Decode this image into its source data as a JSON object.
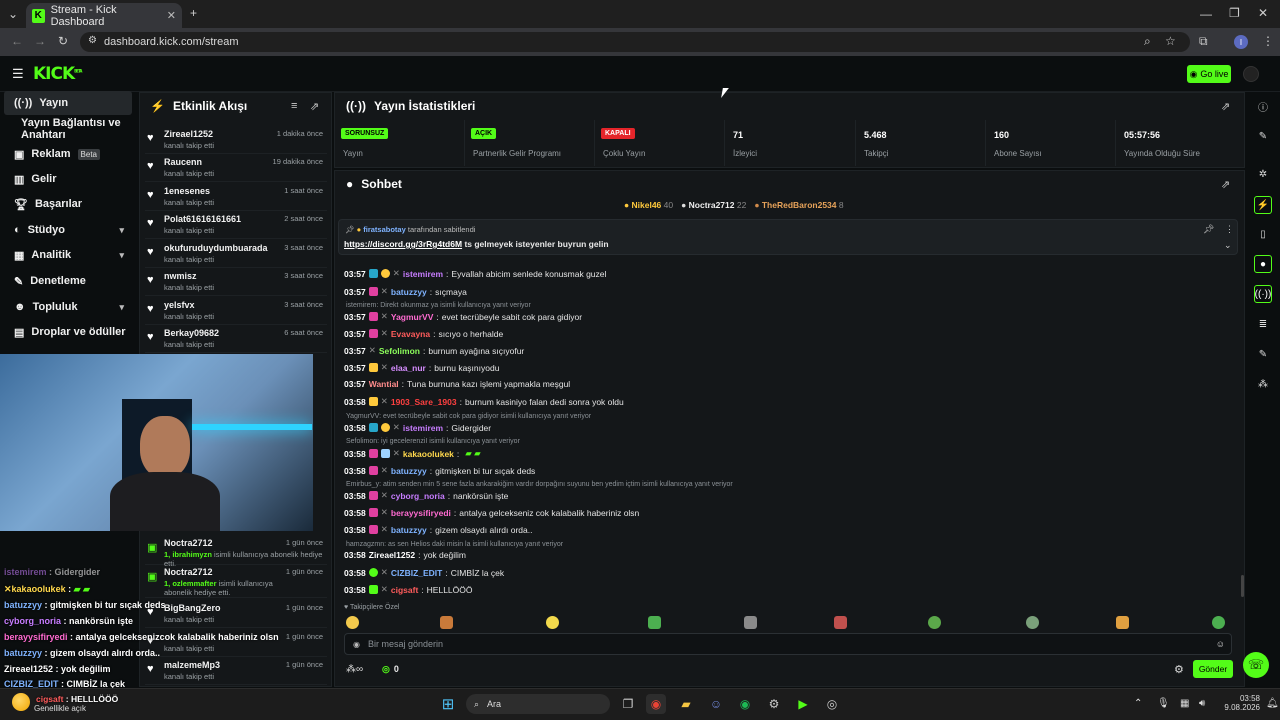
{
  "browser": {
    "tab_title": "Stream - Kick Dashboard",
    "url": "dashboard.kick.com/stream",
    "profile_initial": "I"
  },
  "header": {
    "logo": "KICK",
    "logo_sup": "BETA",
    "go_live": "Go live"
  },
  "sidebar": {
    "items": [
      {
        "label": "Yayın"
      },
      {
        "label": "Yayın Bağlantısı ve Anahtarı"
      },
      {
        "label": "Reklam",
        "badge": "Beta"
      },
      {
        "label": "Gelir"
      },
      {
        "label": "Başarılar"
      },
      {
        "label": "Stüdyo"
      },
      {
        "label": "Analitik"
      },
      {
        "label": "Denetleme"
      },
      {
        "label": "Topluluk"
      },
      {
        "label": "Droplar ve ödüller"
      }
    ]
  },
  "activity": {
    "title": "Etkinlik Akışı",
    "events": [
      {
        "name": "Zireael1252",
        "sub": "kanalı takip etti",
        "time": "1 dakika önce"
      },
      {
        "name": "Raucenn",
        "sub": "kanalı takip etti",
        "time": "19 dakika önce"
      },
      {
        "name": "1enesenes",
        "sub": "kanalı takip etti",
        "time": "1 saat önce"
      },
      {
        "name": "Polat61616161661",
        "sub": "kanalı takip etti",
        "time": "2 saat önce"
      },
      {
        "name": "okufuruduydumbuarada",
        "sub": "kanalı takip etti",
        "time": "3 saat önce"
      },
      {
        "name": "nwmisz",
        "sub": "kanalı takip etti",
        "time": "3 saat önce"
      },
      {
        "name": "yelsfvx",
        "sub": "kanalı takip etti",
        "time": "3 saat önce"
      },
      {
        "name": "Berkay09682",
        "sub": "kanalı takip etti",
        "time": "6 saat önce"
      }
    ],
    "gift_events": [
      {
        "name": "Noctra2712",
        "sub_user": "1, ibrahimyzn",
        "sub": "isimli kullanıcıya abonelik hediye etti.",
        "time": "1 gün önce"
      },
      {
        "name": "Noctra2712",
        "sub_user": "1, ozlemmafter",
        "sub": "isimli kullanıcıya abonelik hediye etti.",
        "time": "1 gün önce"
      },
      {
        "name": "BigBangZero",
        "sub": "kanalı takip etti",
        "time": "1 gün önce"
      },
      {
        "name": "",
        "sub": "kanalı takip etti",
        "time": "1 gün önce"
      },
      {
        "name": "malzemeMp3",
        "sub": "kanalı takip etti",
        "time": "1 gün önce"
      }
    ]
  },
  "stats": {
    "title": "Yayın İstatistikleri",
    "items": [
      {
        "pill": "SORUNSUZ",
        "label": "Yayın"
      },
      {
        "pill": "AÇIK",
        "label": "Partnerlik Gelir Programı"
      },
      {
        "pill": "KAPALI",
        "label": "Çoklu Yayın"
      },
      {
        "value": "71",
        "label": "İzleyici"
      },
      {
        "value": "5.468",
        "label": "Takipçi"
      },
      {
        "value": "160",
        "label": "Abone Sayısı"
      },
      {
        "value": "05:57:56",
        "label": "Yayında Olduğu Süre"
      }
    ]
  },
  "chat": {
    "title": "Sohbet",
    "top": [
      {
        "name": "Nikel46",
        "count": "40"
      },
      {
        "name": "Noctra2712",
        "count": "22"
      },
      {
        "name": "TheRedBaron2534",
        "count": "8"
      }
    ],
    "pinned_by": "firatsabotay",
    "pinned_suffix": "tarafından sabitlendi",
    "pinned_link": "https://discord.gg/3rRg4td6M",
    "pinned_text": "ts gelmeyek isteyenler buyrun gelin",
    "messages": [
      {
        "time": "03:57",
        "user": "istemirem",
        "text": "Eyvallah abicim senlede konusmak guzel",
        "color": "#c77dff"
      },
      {
        "time": "03:57",
        "user": "batuzzyy",
        "text": "sıçmaya",
        "color": "#7fb3ff"
      },
      {
        "reply": "istemirem: Direkt okunmaz ya isimli kullanıcıya yanıt veriyor"
      },
      {
        "time": "03:57",
        "user": "YagmurVV",
        "text": "evet tecrübeyle sabit cok para gidiyor",
        "color": "#ff6bd1"
      },
      {
        "time": "03:57",
        "user": "Evavayna",
        "text": "sıcıyo o herhalde",
        "color": "#ff5c5c"
      },
      {
        "time": "03:57",
        "user": "Sefolimon",
        "text": "burnum ayağına sıçıyofur",
        "color": "#8dff5c"
      },
      {
        "time": "03:57",
        "user": "elaa_nur",
        "text": "burnu kaşınıyodu",
        "color": "#d68dff"
      },
      {
        "time": "03:57",
        "user": "Wantial",
        "text": "Tuna burnuna kazı işlemi yapmakla meşgul",
        "color": "#ff8c8c"
      },
      {
        "time": "03:58",
        "user": "1903_Sare_1903",
        "text": "burnum kasiniyo falan dedi sonra yok oldu",
        "color": "#ff4040"
      },
      {
        "reply": "YagmurVV: evet tecrübeyle sabit cok para gidiyor isimli kullanıcıya yanıt veriyor"
      },
      {
        "time": "03:58",
        "user": "istemirem",
        "text": "Gidergider",
        "color": "#c77dff"
      },
      {
        "reply": "Sefolimon: iyi gecelerenziI isimli kullanıcıya yanıt veriyor"
      },
      {
        "time": "03:58",
        "user": "kakaoolukek",
        "text": "",
        "color": "#ffd84d"
      },
      {
        "time": "03:58",
        "user": "batuzzyy",
        "text": "gitmişken bi tur sıçak deds",
        "color": "#7fb3ff"
      },
      {
        "reply": "Emirbus_y: atim senden min 5 sene fazla ankarakiğim vardır dorpağını suyunu ben yedim içtim isimli kullanıcıya yanıt veriyor"
      },
      {
        "time": "03:58",
        "user": "cyborg_noria",
        "text": "nankörsün işte",
        "color": "#c77dff"
      },
      {
        "time": "03:58",
        "user": "berayysifiryedi",
        "text": "antalya gelcekseniz cok kalabalik haberiniz olsn",
        "color": "#ff6bd1"
      },
      {
        "time": "03:58",
        "user": "batuzzyy",
        "text": "gizem olsaydı alırdı orda..",
        "color": "#7fb3ff"
      },
      {
        "reply": "hamzagzmn: as sen Helios daki misin la isimli kullanıcıya yanıt veriyor"
      },
      {
        "time": "03:58",
        "user": "Zireael1252",
        "text": "yok değilim",
        "color": "#ffffff"
      },
      {
        "time": "03:58",
        "user": "CIZBIZ_EDIT",
        "text": "CIMBİZ la çek",
        "color": "#7fb3ff"
      },
      {
        "time": "03:58",
        "user": "cigsaft",
        "text": "HELLLÖÖÖ",
        "color": "#ff5c5c"
      }
    ],
    "follower_only": "Takipçilere Özel",
    "input_placeholder": "Bir mesaj gönderin",
    "send": "Gönder",
    "points": "0"
  },
  "overlay": {
    "lines": [
      {
        "user": "istemirem",
        "text": "Gidergider",
        "color": "#c77dff"
      },
      {
        "user": "kakaoolukek",
        "text": "",
        "color": "#ffd84d"
      },
      {
        "user": "batuzzyy",
        "text": "gitmişken bi tur sıçak deds",
        "color": "#7fb3ff"
      },
      {
        "user": "cyborg_noria",
        "text": "nankörsün işte",
        "color": "#c77dff"
      },
      {
        "user": "berayysifiryedi",
        "text": "antalya gelceksenizcok kalabalik haberiniz olsn",
        "color": "#ff6bd1"
      },
      {
        "user": "batuzzyy",
        "text": "gizem olsaydı alırdı orda..",
        "color": "#7fb3ff"
      },
      {
        "user": "Zireael1252",
        "text": "yok değilim",
        "color": "#ffffff"
      },
      {
        "user": "CIZBIZ_EDIT",
        "text": "CIMBİZ la çek",
        "color": "#7fb3ff"
      },
      {
        "user": "cigsaft",
        "text": "HELLLÖÖÖ",
        "color": "#ff5c5c"
      }
    ]
  },
  "taskbar": {
    "search": "Ara",
    "weather": "Genellikle açık",
    "time": "03:58",
    "date": "9.08.2026"
  },
  "colors": {
    "accent": "#53fc18"
  }
}
